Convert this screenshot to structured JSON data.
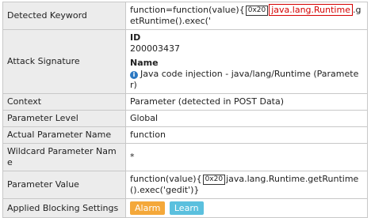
{
  "rows": {
    "detected_keyword": {
      "label": "Detected Keyword",
      "pre": "function=function(value){",
      "hex": "0x20",
      "keyword": "java.lang.Runtime",
      "post": ".getRuntime().exec('"
    },
    "attack_signature": {
      "label": "Attack Signature",
      "id_title": "ID",
      "id_value": "200003437",
      "name_title": "Name",
      "name_value": "Java code injection - java/lang/Runtime (Parameter)"
    },
    "context": {
      "label": "Context",
      "value": "Parameter (detected in POST Data)"
    },
    "parameter_level": {
      "label": "Parameter Level",
      "value": "Global"
    },
    "actual_parameter_name": {
      "label": "Actual Parameter Name",
      "value": "function"
    },
    "wildcard_parameter_name": {
      "label": "Wildcard Parameter Name",
      "value": "*"
    },
    "parameter_value": {
      "label": "Parameter Value",
      "pre": "function(value){",
      "hex": "0x20",
      "post": "java.lang.Runtime.getRuntime().exec('gedit')}"
    },
    "applied_blocking_settings": {
      "label": "Applied Blocking Settings",
      "alarm": "Alarm",
      "learn": "Learn"
    }
  },
  "icons": {
    "info": "info-icon"
  },
  "colors": {
    "keyword_highlight": "#d40000",
    "alarm": "#f4a83a",
    "learn": "#5bc0de",
    "label_bg": "#ececec"
  }
}
